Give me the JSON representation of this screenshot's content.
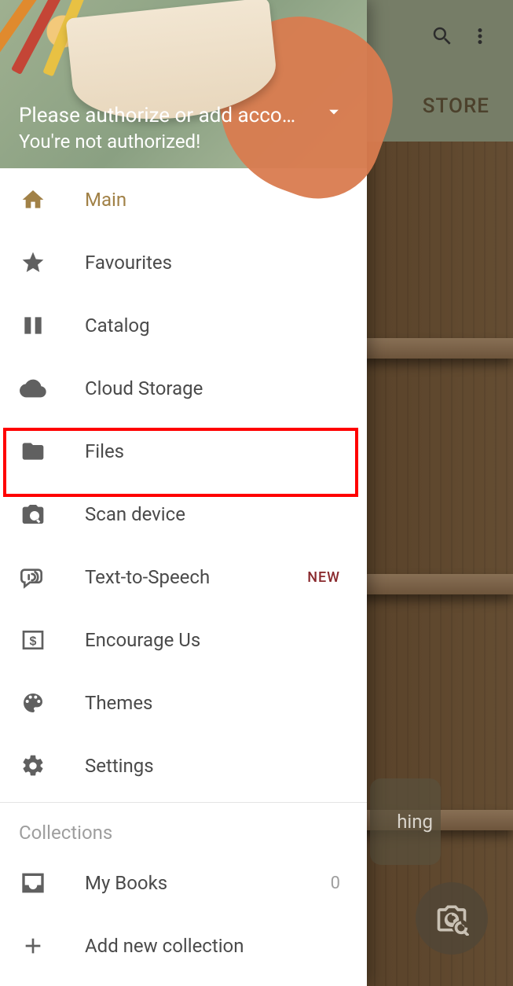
{
  "appbar": {
    "store_label": "STORE"
  },
  "tooltip_fragment": "hing",
  "drawer": {
    "header": {
      "line1": "Please authorize or add acco…",
      "line2": "You're not authorized!"
    },
    "items": [
      {
        "icon": "home-icon",
        "label": "Main",
        "active": true
      },
      {
        "icon": "star-icon",
        "label": "Favourites"
      },
      {
        "icon": "catalog-icon",
        "label": "Catalog"
      },
      {
        "icon": "cloud-icon",
        "label": "Cloud Storage"
      },
      {
        "icon": "folder-icon",
        "label": "Files"
      },
      {
        "icon": "scan-icon",
        "label": "Scan device"
      },
      {
        "icon": "tts-icon",
        "label": "Text-to-Speech",
        "badge": "NEW"
      },
      {
        "icon": "dollar-icon",
        "label": "Encourage Us"
      },
      {
        "icon": "palette-icon",
        "label": "Themes"
      },
      {
        "icon": "gear-icon",
        "label": "Settings"
      }
    ],
    "collections_title": "Collections",
    "collections": [
      {
        "icon": "inbox-icon",
        "label": "My Books",
        "count": 0
      },
      {
        "icon": "plus-icon",
        "label": "Add new collection"
      }
    ]
  }
}
